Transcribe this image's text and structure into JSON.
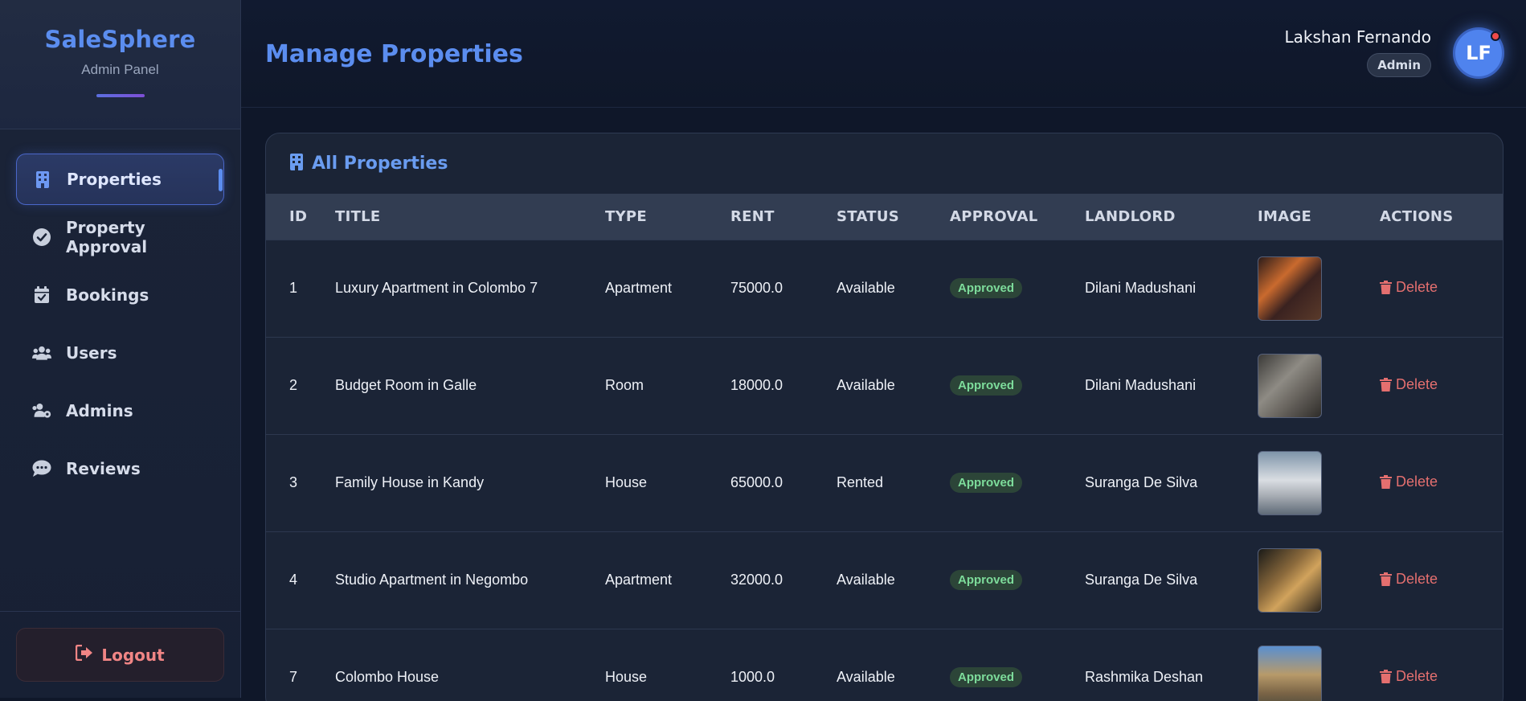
{
  "brand": {
    "title": "SaleSphere",
    "subtitle": "Admin Panel"
  },
  "sidebar": {
    "items": [
      {
        "label": "Properties",
        "icon": "building-icon",
        "active": true
      },
      {
        "label": "Property Approval",
        "icon": "check-circle-icon"
      },
      {
        "label": "Bookings",
        "icon": "calendar-check-icon"
      },
      {
        "label": "Users",
        "icon": "users-icon"
      },
      {
        "label": "Admins",
        "icon": "users-cog-icon"
      },
      {
        "label": "Reviews",
        "icon": "comment-dots-icon"
      }
    ],
    "logout_label": "Logout"
  },
  "header": {
    "title": "Manage Properties",
    "user_name": "Lakshan Fernando",
    "user_role": "Admin",
    "avatar_initials": "LF"
  },
  "card": {
    "title": "All Properties",
    "columns": [
      "ID",
      "TITLE",
      "TYPE",
      "RENT",
      "STATUS",
      "APPROVAL",
      "LANDLORD",
      "IMAGE",
      "ACTIONS"
    ],
    "rows": [
      {
        "id": "1",
        "title": "Luxury Apartment in Colombo 7",
        "type": "Apartment",
        "rent": "75000.0",
        "status": "Available",
        "approval": "Approved",
        "landlord": "Dilani Madushani",
        "action": "Delete"
      },
      {
        "id": "2",
        "title": "Budget Room in Galle",
        "type": "Room",
        "rent": "18000.0",
        "status": "Available",
        "approval": "Approved",
        "landlord": "Dilani Madushani",
        "action": "Delete"
      },
      {
        "id": "3",
        "title": "Family House in Kandy",
        "type": "House",
        "rent": "65000.0",
        "status": "Rented",
        "approval": "Approved",
        "landlord": "Suranga De Silva",
        "action": "Delete"
      },
      {
        "id": "4",
        "title": "Studio Apartment in Negombo",
        "type": "Apartment",
        "rent": "32000.0",
        "status": "Available",
        "approval": "Approved",
        "landlord": "Suranga De Silva",
        "action": "Delete"
      },
      {
        "id": "7",
        "title": "Colombo House",
        "type": "House",
        "rent": "1000.0",
        "status": "Available",
        "approval": "Approved",
        "landlord": "Rashmika Deshan",
        "action": "Delete"
      }
    ]
  },
  "colors": {
    "accent": "#5b8def",
    "approved": "#7ddc9b",
    "danger": "#e46f6f",
    "background": "#0f1729"
  }
}
